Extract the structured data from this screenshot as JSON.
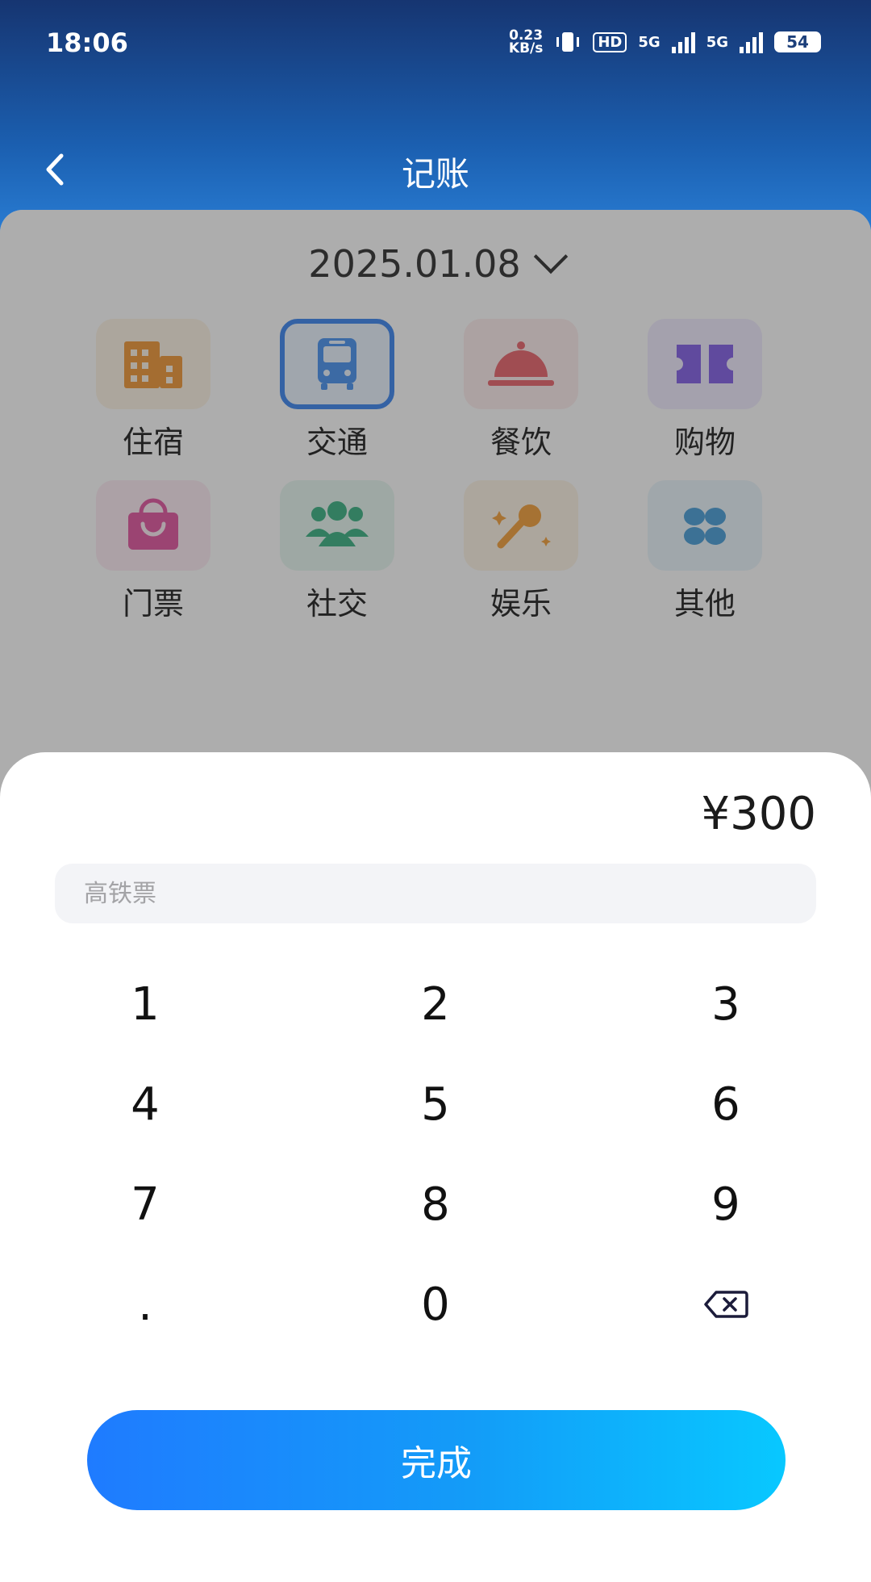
{
  "status_bar": {
    "time": "18:06",
    "network_speed": "0.23",
    "network_speed_unit": "KB/s",
    "hd_label": "HD",
    "signal_label_1": "5G",
    "signal_label_2": "5G",
    "battery": "54"
  },
  "nav": {
    "title": "记账",
    "back_icon": "chevron-left-icon"
  },
  "date": {
    "value": "2025.01.08",
    "icon": "chevron-down-icon"
  },
  "categories": [
    {
      "label": "住宿",
      "icon": "building-icon",
      "bg": "#fdf3e4",
      "fg": "#f0922a",
      "selected": false
    },
    {
      "label": "交通",
      "icon": "bus-icon",
      "bg": "#e8f3ff",
      "fg": "#3d8cf0",
      "selected": true
    },
    {
      "label": "餐饮",
      "icon": "food-cloche-icon",
      "bg": "#fdecec",
      "fg": "#e85a62",
      "selected": false
    },
    {
      "label": "购物",
      "icon": "ticket-icon",
      "bg": "#efeaff",
      "fg": "#7a55e6",
      "selected": false
    },
    {
      "label": "门票",
      "icon": "shopping-bag-icon",
      "bg": "#fdebf3",
      "fg": "#e04a9a",
      "selected": false
    },
    {
      "label": "社交",
      "icon": "people-icon",
      "bg": "#e6f6ef",
      "fg": "#2eac7a",
      "selected": false
    },
    {
      "label": "娱乐",
      "icon": "microphone-icon",
      "bg": "#fdf3e4",
      "fg": "#f39a2e",
      "selected": false
    },
    {
      "label": "其他",
      "icon": "grid-four-icon",
      "bg": "#e8f4fb",
      "fg": "#3d98d6",
      "selected": false
    }
  ],
  "sheet": {
    "amount": "¥300",
    "note_value": "",
    "note_placeholder": "高铁票",
    "keys": [
      "1",
      "2",
      "3",
      "4",
      "5",
      "6",
      "7",
      "8",
      "9",
      ".",
      "0"
    ],
    "backspace_icon": "backspace-icon",
    "done_label": "完成"
  },
  "colors": {
    "accent_start": "#1f7bff",
    "accent_end": "#08c8ff",
    "header_dark": "#163571"
  }
}
